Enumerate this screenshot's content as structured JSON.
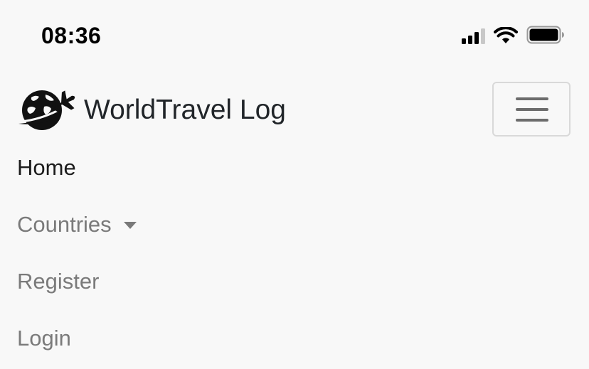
{
  "status_bar": {
    "time": "08:36",
    "signal_icon": "cellular-signal-icon",
    "wifi_icon": "wifi-icon",
    "battery_icon": "battery-icon",
    "battery_level": 0.9
  },
  "navbar": {
    "brand": {
      "logo_icon": "globe-airplane-icon",
      "text": "WorldTravel Log"
    },
    "toggler_icon": "hamburger-menu-icon",
    "items": [
      {
        "label": "Home",
        "active": true
      },
      {
        "label": "Countries",
        "dropdown": true
      },
      {
        "label": "Register"
      },
      {
        "label": "Login"
      }
    ]
  },
  "colors": {
    "background": "#f8f8f8",
    "text_active": "#1c1c1c",
    "text_muted": "#7a7a7a",
    "toggler_border": "#d9d9d9"
  }
}
